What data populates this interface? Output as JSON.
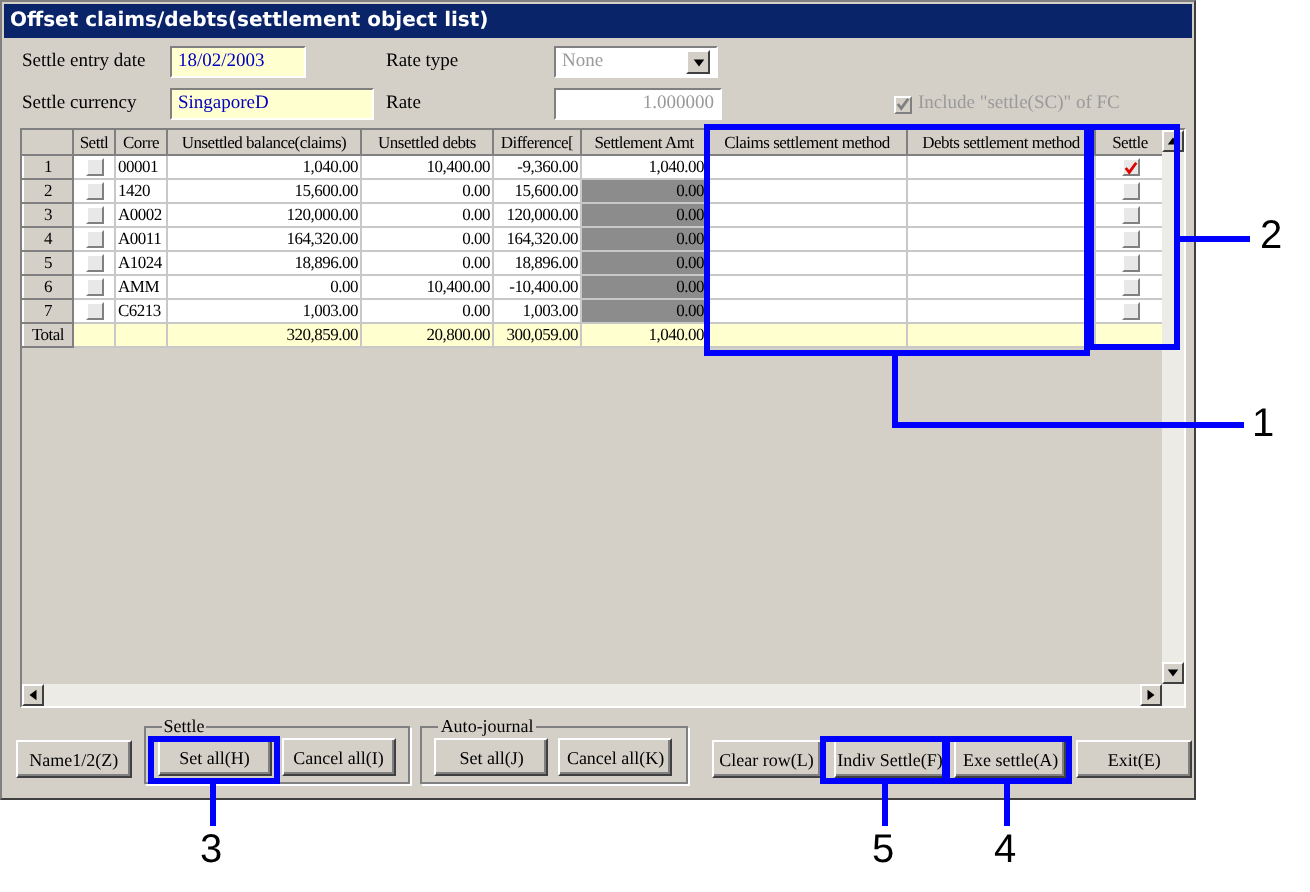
{
  "window": {
    "title": "Offset claims/debts(settlement object list)"
  },
  "form": {
    "entry_date_label": "Settle entry date",
    "entry_date": "18/02/2003",
    "currency_label": "Settle currency",
    "currency": "SingaporeD",
    "rate_type_label": "Rate type",
    "rate_type": "None",
    "rate_type_disabled": true,
    "rate_label": "Rate",
    "rate": "1.000000",
    "rate_disabled": true,
    "include_checkbox": {
      "label": "Include \"settle(SC)\" of FC",
      "checked": true,
      "disabled": true
    }
  },
  "table": {
    "columns": [
      "Settl",
      "Corre",
      "Unsettled balance(claims)",
      "Unsettled debts",
      "Difference[",
      "Settlement Amt",
      "Claims settlement method",
      "Debts settlement method",
      "Settle"
    ],
    "rows": [
      {
        "number": "1",
        "settl_checked": false,
        "corre": "00001",
        "claims": "1,040.00",
        "debts": "10,400.00",
        "difference": "-9,360.00",
        "amount": "1,040.00",
        "amount_locked": false,
        "settle_checked": true
      },
      {
        "number": "2",
        "settl_checked": false,
        "corre": "1420",
        "claims": "15,600.00",
        "debts": "0.00",
        "difference": "15,600.00",
        "amount": "0.00",
        "amount_locked": true,
        "settle_checked": false
      },
      {
        "number": "3",
        "settl_checked": false,
        "corre": "A0002",
        "claims": "120,000.00",
        "debts": "0.00",
        "difference": "120,000.00",
        "amount": "0.00",
        "amount_locked": true,
        "settle_checked": false
      },
      {
        "number": "4",
        "settl_checked": false,
        "corre": "A0011",
        "claims": "164,320.00",
        "debts": "0.00",
        "difference": "164,320.00",
        "amount": "0.00",
        "amount_locked": true,
        "settle_checked": false
      },
      {
        "number": "5",
        "settl_checked": false,
        "corre": "A1024",
        "claims": "18,896.00",
        "debts": "0.00",
        "difference": "18,896.00",
        "amount": "0.00",
        "amount_locked": true,
        "settle_checked": false
      },
      {
        "number": "6",
        "settl_checked": false,
        "corre": "AMM",
        "claims": "0.00",
        "debts": "10,400.00",
        "difference": "-10,400.00",
        "amount": "0.00",
        "amount_locked": true,
        "settle_checked": false
      },
      {
        "number": "7",
        "settl_checked": false,
        "corre": "C6213",
        "claims": "1,003.00",
        "debts": "0.00",
        "difference": "1,003.00",
        "amount": "0.00",
        "amount_locked": true,
        "settle_checked": false
      }
    ],
    "total": {
      "label": "Total",
      "claims": "320,859.00",
      "debts": "20,800.00",
      "difference": "300,059.00",
      "amount": "1,040.00"
    }
  },
  "buttons": {
    "name": "Name1/2(Z)",
    "settle_group": {
      "title": "Settle",
      "set_all": "Set all(H)",
      "cancel_all": "Cancel all(I)"
    },
    "journal_group": {
      "title": "Auto-journal",
      "set_all": "Set all(J)",
      "cancel_all": "Cancel all(K)"
    },
    "clear_row": "Clear row(L)",
    "indiv_settle": "Indiv Settle(F)",
    "exe_settle": "Exe settle(A)",
    "exit": "Exit(E)"
  },
  "callouts": [
    {
      "label": "1"
    },
    {
      "label": "2"
    },
    {
      "label": "3"
    },
    {
      "label": "5"
    },
    {
      "label": "4"
    }
  ]
}
